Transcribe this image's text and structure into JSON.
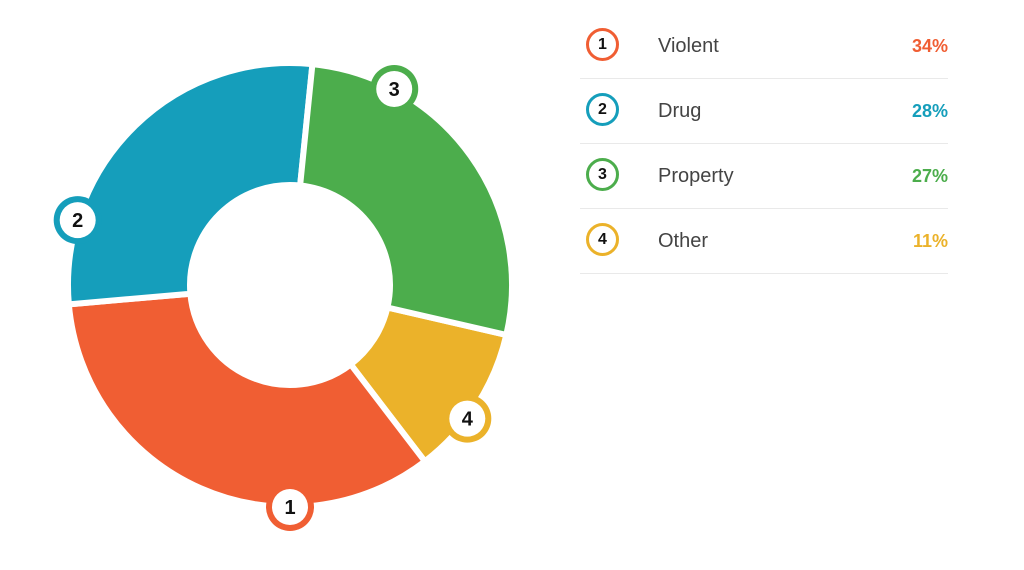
{
  "chart_data": {
    "type": "pie",
    "categories": [
      "Violent",
      "Drug",
      "Property",
      "Other"
    ],
    "values": [
      34,
      28,
      27,
      11
    ],
    "badges": [
      "1",
      "2",
      "3",
      "4"
    ],
    "value_labels": [
      "34%",
      "28%",
      "27%",
      "11%"
    ],
    "colors": [
      "#f05e33",
      "#159ebb",
      "#4cad4c",
      "#ebb22a"
    ],
    "legend_placement": "right"
  }
}
